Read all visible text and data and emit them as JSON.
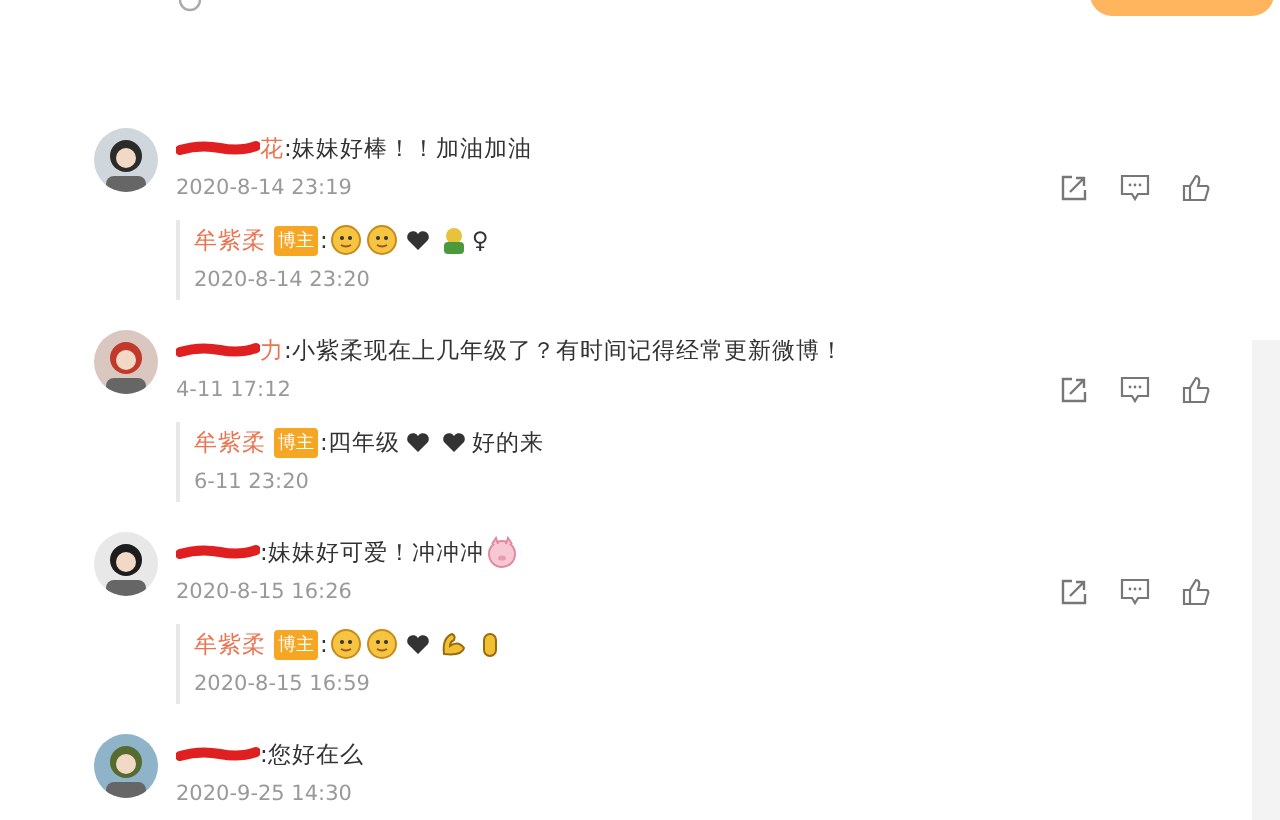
{
  "comments": [
    {
      "redacted": true,
      "name": "花",
      "content": [
        {
          "kind": "text",
          "text": ":妹妹好棒！！加油加油"
        }
      ],
      "time": "2020-8-14 23:19",
      "show_actions": true,
      "reply": {
        "name": "牟紫柔",
        "badge": "博主",
        "content": [
          {
            "kind": "text",
            "text": ":"
          },
          {
            "kind": "face"
          },
          {
            "kind": "face"
          },
          {
            "kind": "heart"
          },
          {
            "kind": "frog"
          },
          {
            "kind": "text",
            "text": "♀"
          }
        ],
        "time": "2020-8-14 23:20"
      }
    },
    {
      "redacted": true,
      "name": "力",
      "content": [
        {
          "kind": "text",
          "text": ":小紫柔现在上几年级了？有时间记得经常更新微博！"
        }
      ],
      "time": "4-11 17:12",
      "show_actions": true,
      "reply": {
        "name": "牟紫柔",
        "badge": "博主",
        "content": [
          {
            "kind": "text",
            "text": ":四年级"
          },
          {
            "kind": "heart"
          },
          {
            "kind": "heart"
          },
          {
            "kind": "text",
            "text": "好的来"
          }
        ],
        "time": "6-11 23:20"
      }
    },
    {
      "redacted": true,
      "content": [
        {
          "kind": "text",
          "text": ":妹妹好可爱！冲冲冲"
        },
        {
          "kind": "pig"
        }
      ],
      "time": "2020-8-15 16:26",
      "show_actions": true,
      "reply": {
        "name": "牟紫柔",
        "badge": "博主",
        "content": [
          {
            "kind": "text",
            "text": ":"
          },
          {
            "kind": "face"
          },
          {
            "kind": "face"
          },
          {
            "kind": "heart"
          },
          {
            "kind": "muscle"
          },
          {
            "kind": "hand"
          }
        ],
        "time": "2020-8-15 16:59"
      }
    },
    {
      "redacted": true,
      "content": [
        {
          "kind": "text",
          "text": ":您好在么"
        }
      ],
      "time": "2020-9-25 14:30",
      "show_actions": false
    }
  ]
}
